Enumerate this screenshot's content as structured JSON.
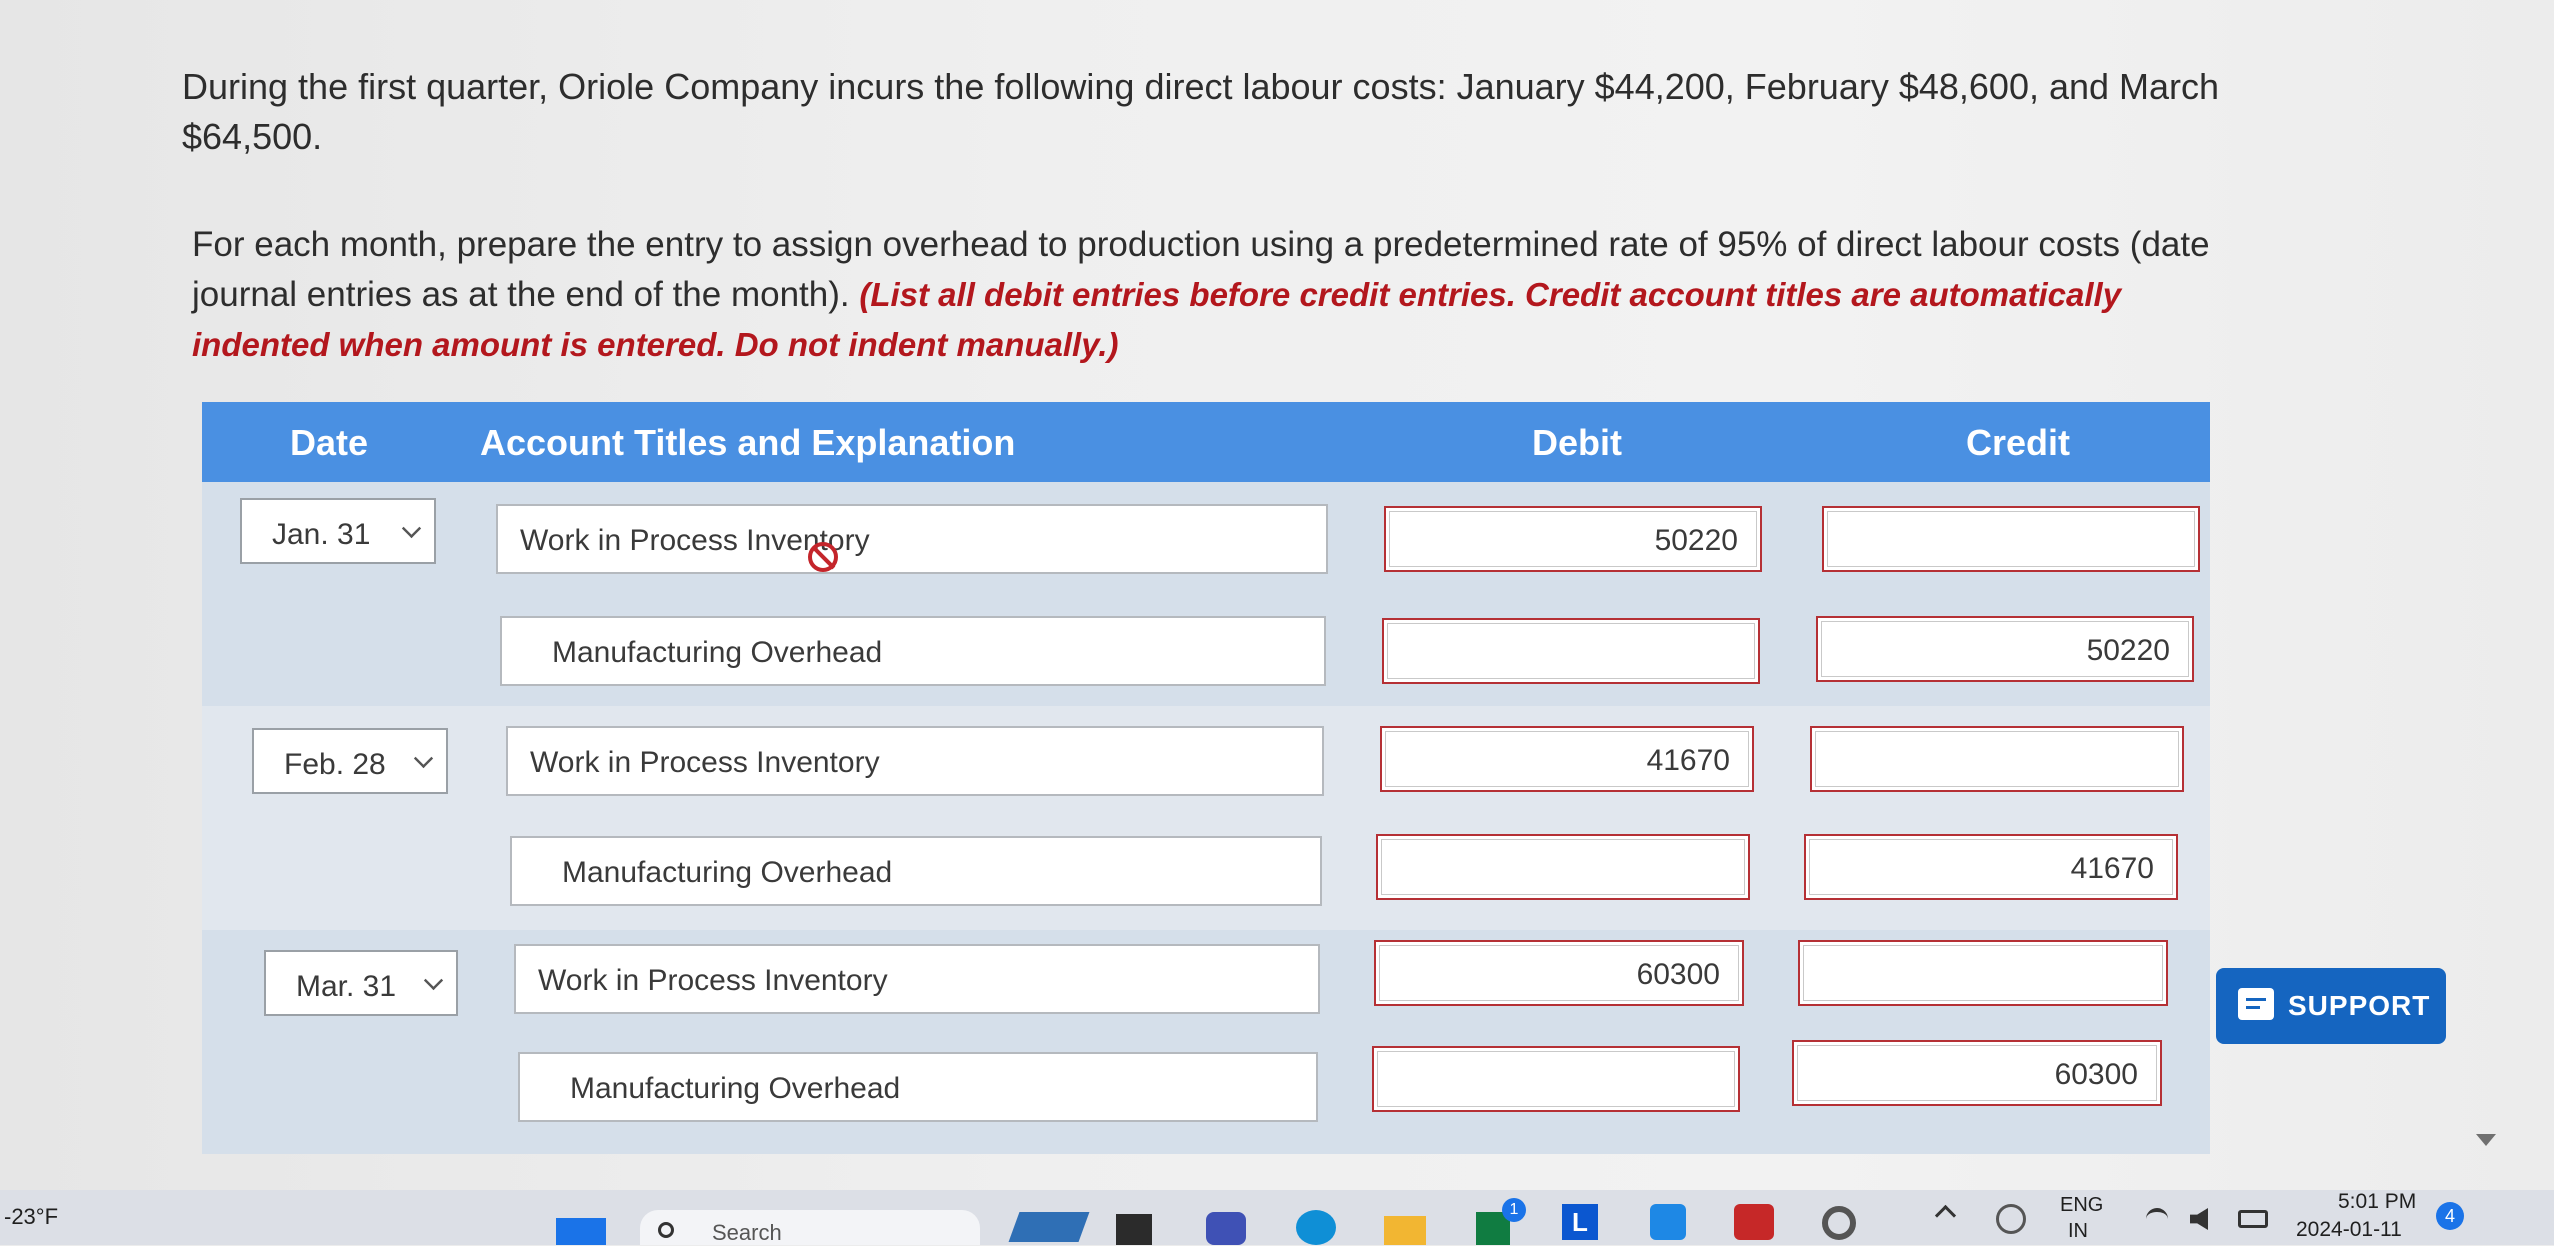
{
  "problem": {
    "intro": "During the first quarter, Oriole Company incurs the following direct labour costs: January $44,200, February $48,600, and March $64,500.",
    "instruction": "For each month, prepare the entry to assign overhead to production using a predetermined rate of 95% of direct labour costs (date journal entries as at the end of the month).",
    "note": "(List all debit entries before credit entries. Credit account titles are automatically indented when amount is entered. Do not indent manually.)"
  },
  "table": {
    "headers": {
      "date": "Date",
      "account": "Account Titles and Explanation",
      "debit": "Debit",
      "credit": "Credit"
    },
    "entries": [
      {
        "date": "Jan. 31",
        "debit_account": "Work in Process Inventory",
        "debit_amount": "50220",
        "credit_account": "Manufacturing Overhead",
        "credit_amount": "50220"
      },
      {
        "date": "Feb. 28",
        "debit_account": "Work in Process Inventory",
        "debit_amount": "41670",
        "credit_account": "Manufacturing Overhead",
        "credit_amount": "41670"
      },
      {
        "date": "Mar. 31",
        "debit_account": "Work in Process Inventory",
        "debit_amount": "60300",
        "credit_account": "Manufacturing Overhead",
        "credit_amount": "60300"
      }
    ]
  },
  "support_label": "SUPPORT",
  "taskbar": {
    "weather": "-23°F",
    "search": "Search",
    "lang1": "ENG",
    "lang2": "IN",
    "time": "5:01 PM",
    "date": "2024-01-11",
    "notifications": "4",
    "badge": "1"
  },
  "colors": {
    "header": "#4a90e2",
    "support": "#1565c0",
    "note_red": "#b3171d",
    "input_border": "#b53035"
  }
}
